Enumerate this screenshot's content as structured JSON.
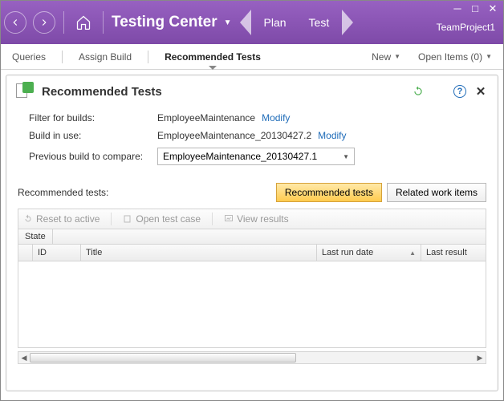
{
  "window": {
    "minimize": "─",
    "maximize": "□",
    "close": "✕"
  },
  "header": {
    "app_title": "Testing Center",
    "plan": "Plan",
    "test": "Test",
    "team_project": "TeamProject1"
  },
  "tabs": {
    "queries": "Queries",
    "assign_build": "Assign Build",
    "recommended_tests": "Recommended Tests",
    "new": "New",
    "open_items": "Open Items (0)"
  },
  "panel": {
    "title": "Recommended Tests",
    "help": "?",
    "close": "✕"
  },
  "filter": {
    "filter_label": "Filter for builds:",
    "filter_value": "EmployeeMaintenance",
    "modify": "Modify",
    "build_in_use_label": "Build in use:",
    "build_in_use_value": "EmployeeMaintenance_20130427.2",
    "prev_build_label": "Previous build to compare:",
    "prev_build_value": "EmployeeMaintenance_20130427.1"
  },
  "section": {
    "label": "Recommended tests:",
    "btn_recommended": "Recommended tests",
    "btn_related": "Related work items"
  },
  "toolbar": {
    "reset": "Reset to active",
    "open_case": "Open test case",
    "view_results": "View results"
  },
  "grid": {
    "state": "State",
    "col_id": "ID",
    "col_title": "Title",
    "col_lastrun": "Last run date",
    "col_lastresult": "Last result"
  }
}
